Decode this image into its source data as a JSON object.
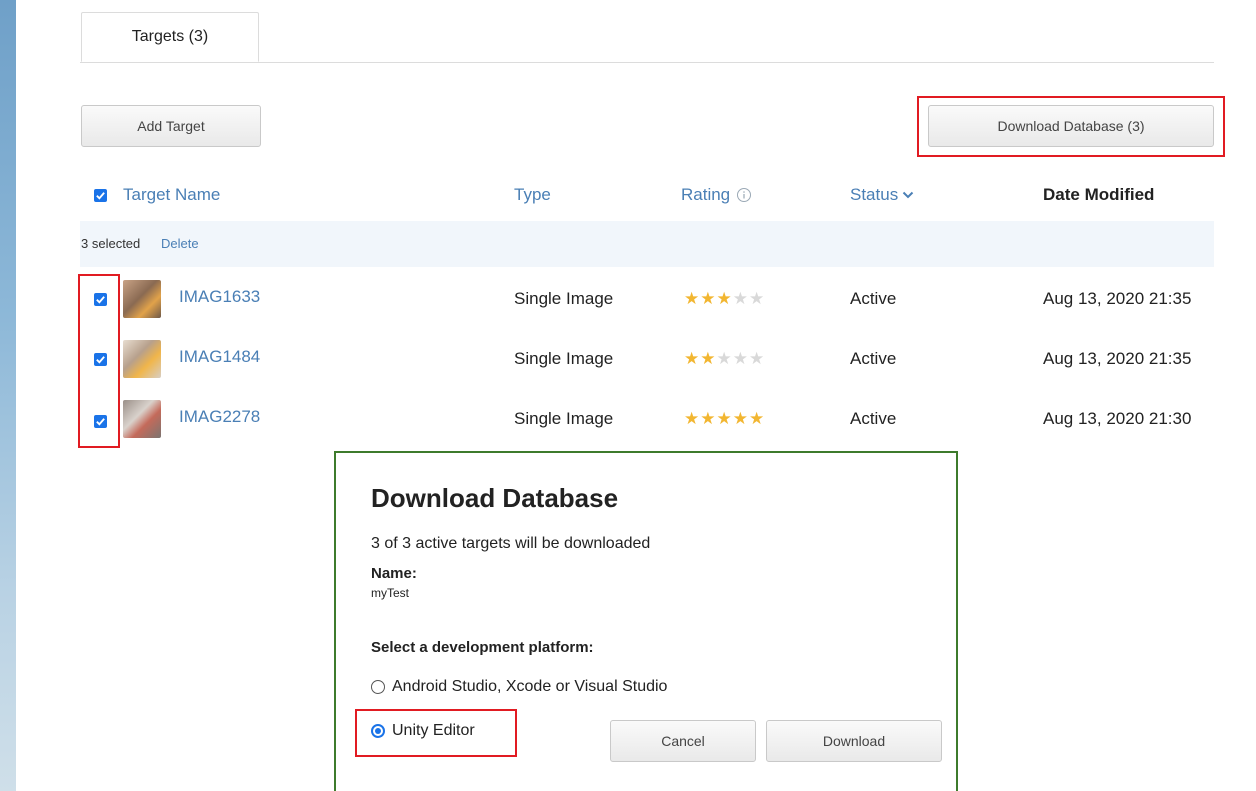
{
  "tabs": [
    {
      "label": "Targets (3)"
    }
  ],
  "toolbar": {
    "add_target": "Add Target",
    "download_database": "Download Database (3)"
  },
  "table": {
    "headers": {
      "name": "Target Name",
      "type": "Type",
      "rating": "Rating",
      "status": "Status",
      "date": "Date Modified"
    },
    "selection": {
      "count_text": "3 selected",
      "delete_label": "Delete"
    },
    "rows": [
      {
        "name": "IMAG1633",
        "type": "Single Image",
        "rating": 3,
        "status": "Active",
        "date": "Aug 13, 2020 21:35",
        "checked": true
      },
      {
        "name": "IMAG1484",
        "type": "Single Image",
        "rating": 2,
        "status": "Active",
        "date": "Aug 13, 2020 21:35",
        "checked": true
      },
      {
        "name": "IMAG2278",
        "type": "Single Image",
        "rating": 5,
        "status": "Active",
        "date": "Aug 13, 2020 21:30",
        "checked": true
      }
    ]
  },
  "dialog": {
    "title": "Download Database",
    "subtitle": "3 of 3 active targets will be downloaded",
    "name_label": "Name:",
    "name_value": "myTest",
    "platform_label": "Select a development platform:",
    "options": [
      {
        "label": "Android Studio, Xcode or Visual Studio",
        "selected": false
      },
      {
        "label": "Unity Editor",
        "selected": true
      }
    ],
    "cancel_label": "Cancel",
    "download_label": "Download"
  },
  "colors": {
    "link": "#4a7fb5",
    "checkbox": "#1a73e8",
    "highlight_red": "#e11b22",
    "highlight_green": "#3e7b2c",
    "star": "#f2b631"
  },
  "icons": {
    "rating_info": "info-circle-icon",
    "status_sort": "chevron-down-icon",
    "checkbox": "check-icon"
  }
}
